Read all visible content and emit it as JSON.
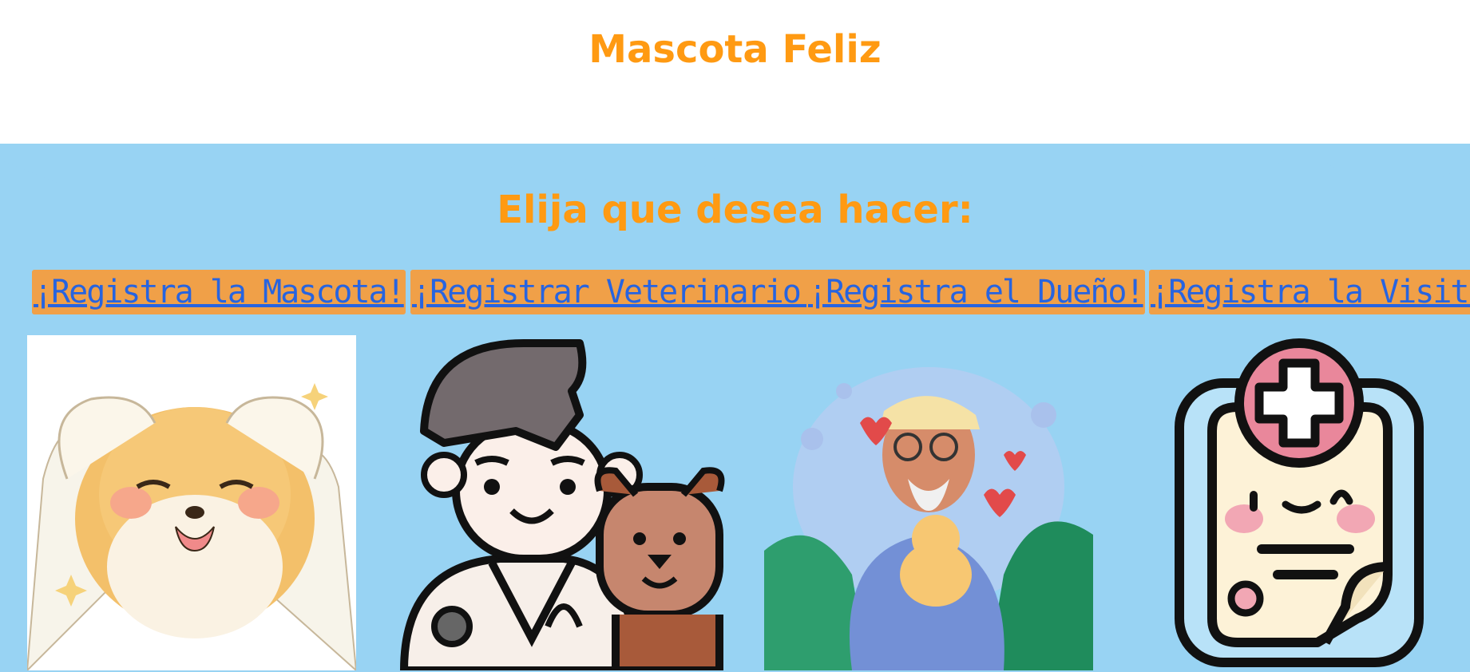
{
  "header": {
    "title": "Mascota Feliz"
  },
  "main": {
    "prompt": "Elija que desea hacer:",
    "options": [
      {
        "label": "¡Registra la Mascota!",
        "icon": "dog-icon"
      },
      {
        "label": "¡Registrar Veterinario!",
        "icon": "veterinarian-icon"
      },
      {
        "label": "¡Registra el Dueño!",
        "icon": "owner-icon"
      },
      {
        "label": "¡Registra la Visita!",
        "icon": "clipboard-icon"
      }
    ]
  },
  "colors": {
    "accent": "#ff9a12",
    "background": "#98d3f3",
    "link": "#2764e0",
    "link_highlight": "#f0a048"
  }
}
